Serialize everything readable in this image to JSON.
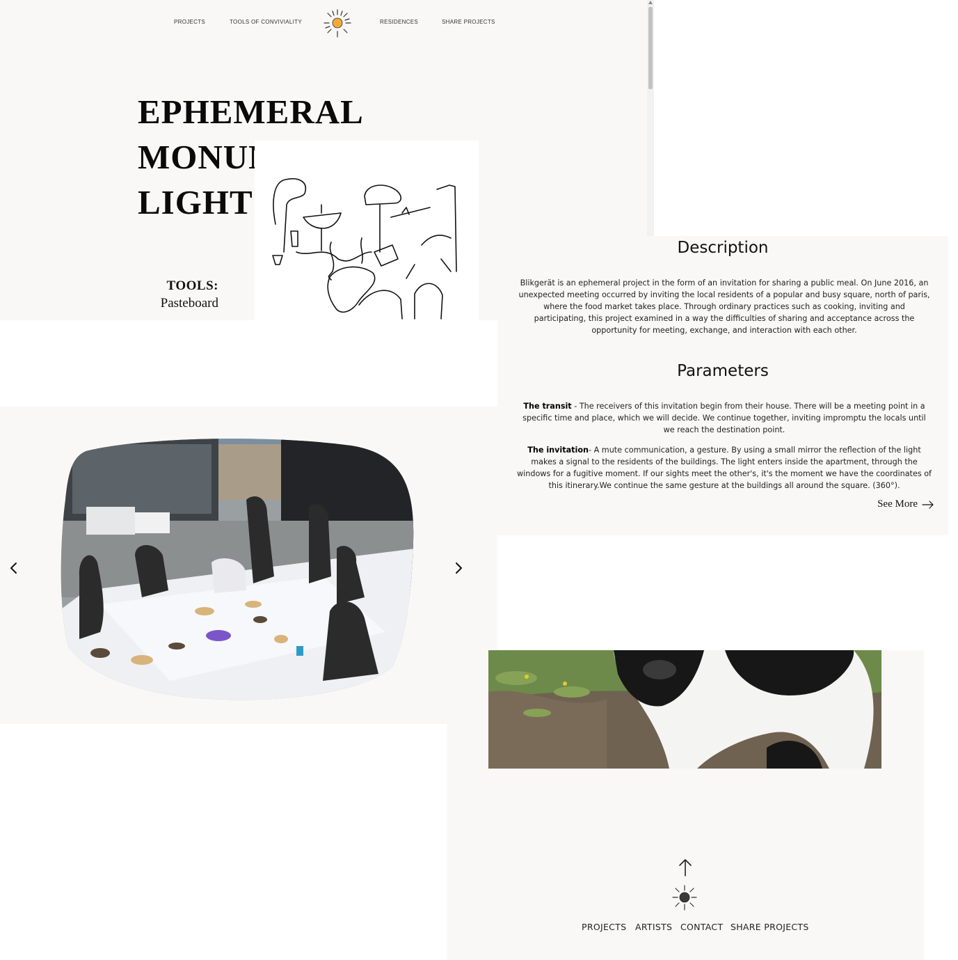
{
  "nav": {
    "projects": "PROJECTS",
    "tools": "TOOLS OF CONVIVIALITY",
    "residences": "RESIDENCES",
    "share": "SHARE PROJECTS"
  },
  "hero": {
    "title_line1": "EPHEMERAL",
    "title_line2": "MONUMENT OF",
    "title_line3": "LIGHT",
    "tools_label": "TOOLS:",
    "tools_value": "Pasteboard"
  },
  "description": {
    "heading": "Description",
    "body": "Blikgerät is an ephemeral project in the form of an invitation for sharing a public meal. On June 2016, an unexpected meeting occurred by inviting the local residents of a popular and busy square, north of paris, where the food market takes place. Through ordinary practices such as cooking, inviting and participating, this project examined in a way the difficulties of sharing and acceptance across the opportunity for meeting, exchange, and interaction with each other."
  },
  "parameters": {
    "heading": "Parameters",
    "transit_label": "The transit",
    "transit_text": " - The receivers of this invitation begin from their house. There will be a meeting point in a specific time and place, which we will decide. We continue together, inviting impromptu the locals until we reach the destination point.",
    "invitation_label": "The invitation",
    "invitation_text": "- A mute communication, a gesture. By using a small mirror the reflection of the light makes a signal to the residents of the buildings. The light enters inside the apartment, through the windows for a fugitive moment. If our sights meet the other's, it's the moment we have the coordinates of this itinerary.We continue the same gesture at the buildings all around the square. (360°).",
    "see_more": "See More"
  },
  "gallery": {
    "prev_icon": "chevron-left-icon",
    "next_icon": "chevron-right-icon"
  },
  "footer": {
    "links": [
      "PROJECTS",
      "ARTISTS",
      "CONTACT",
      "SHARE PROJECTS"
    ]
  },
  "colors": {
    "panel_bg": "#f9f8f6",
    "sun": "#f3a93c",
    "text": "#111111"
  }
}
